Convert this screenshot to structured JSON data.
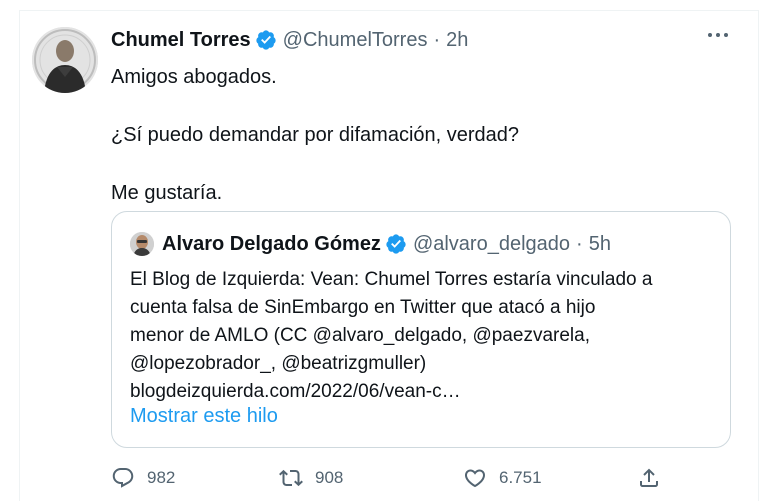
{
  "tweet": {
    "author": {
      "name": "Chumel Torres",
      "handle": "@ChumelTorres",
      "separator": "·",
      "time": "2h"
    },
    "lines": [
      "Amigos abogados.",
      "¿Sí puedo demandar por difamación, verdad?",
      "Me gustaría."
    ]
  },
  "quote": {
    "author": {
      "name": "Alvaro Delgado Gómez",
      "handle": "@alvaro_delgado",
      "separator": "·",
      "time": "5h"
    },
    "lines": [
      "El Blog de Izquierda: Vean: Chumel Torres estaría vinculado a",
      "cuenta falsa de SinEmbargo en Twitter que atacó a hijo",
      "menor de AMLO (CC @alvaro_delgado, @paezvarela,",
      "@lopezobrador_, @beatrizgmuller)",
      "blogdeizquierda.com/2022/06/vean-c…"
    ],
    "show_thread": "Mostrar este hilo"
  },
  "actions": {
    "replies": "982",
    "retweets": "908",
    "likes": "6.751"
  },
  "icons": {
    "verified": "verified-badge-icon",
    "more": "more-icon",
    "reply": "reply-icon",
    "retweet": "retweet-icon",
    "like": "heart-icon",
    "share": "share-icon"
  },
  "colors": {
    "accent": "#1d9bf0",
    "secondary_text": "#536471",
    "primary_text": "#0f1419",
    "border": "#cfd9de"
  }
}
